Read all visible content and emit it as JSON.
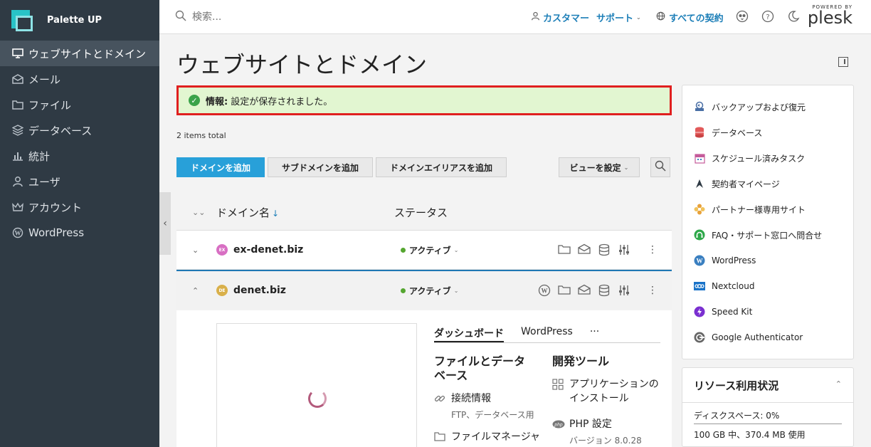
{
  "brand": {
    "name": "Palette UP"
  },
  "sidebar": {
    "items": [
      {
        "label": "ウェブサイトとドメイン",
        "icon": "monitor-icon",
        "active": true
      },
      {
        "label": "メール",
        "icon": "mail-icon"
      },
      {
        "label": "ファイル",
        "icon": "folder-icon"
      },
      {
        "label": "データベース",
        "icon": "database-icon"
      },
      {
        "label": "統計",
        "icon": "chart-icon"
      },
      {
        "label": "ユーザ",
        "icon": "user-icon"
      },
      {
        "label": "アカウント",
        "icon": "crown-icon"
      },
      {
        "label": "WordPress",
        "icon": "wordpress-icon"
      }
    ]
  },
  "topbar": {
    "search_placeholder": "検索...",
    "customer_label": "カスタマー",
    "support_label": "サポート",
    "subscriptions_label": "すべての契約",
    "plesk_powered": "POWERED BY",
    "plesk_name": "plesk"
  },
  "main": {
    "title": "ウェブサイトとドメイン",
    "info_label": "情報:",
    "info_text": "設定が保存されました。",
    "items_total": "2 items total",
    "buttons": {
      "add_domain": "ドメインを追加",
      "add_subdomain": "サブドメインを追加",
      "add_alias": "ドメインエイリアスを追加",
      "view_settings": "ビューを設定"
    },
    "columns": {
      "domain": "ドメイン名",
      "status": "ステータス"
    },
    "domains": [
      {
        "badge": "EX",
        "name": "ex-denet.biz",
        "status": "アクティブ"
      },
      {
        "badge": "DE",
        "name": "denet.biz",
        "status": "アクティブ"
      }
    ],
    "detail": {
      "tabs": [
        "ダッシュボード",
        "WordPress",
        "···"
      ],
      "files_title": "ファイルとデータベース",
      "connect_info": "接続情報",
      "connect_sub": "FTP、データベース用",
      "file_manager": "ファイルマネージャ",
      "dev_title": "開発ツール",
      "app_install": "アプリケーションのインストール",
      "php_settings": "PHP 設定",
      "php_version": "バージョン 8.0.28"
    }
  },
  "rpanel": {
    "items": [
      {
        "label": "バックアップおよび復元",
        "icon": "backup-icon",
        "color": "#4a6fa5"
      },
      {
        "label": "データベース",
        "icon": "database-icon",
        "color": "#e25a5a"
      },
      {
        "label": "スケジュール済みタスク",
        "icon": "calendar-icon",
        "color": "#c45a9a"
      },
      {
        "label": "契約者マイページ",
        "icon": "arrow-logo-icon",
        "color": "#2f3a44"
      },
      {
        "label": "パートナー様専用サイト",
        "icon": "flower-icon",
        "color": "#e8a23b"
      },
      {
        "label": "FAQ・サポート窓口へ問合せ",
        "icon": "headset-icon",
        "color": "#2ea84a"
      },
      {
        "label": "WordPress",
        "icon": "wordpress-icon",
        "color": "#3a7fc0"
      },
      {
        "label": "Nextcloud",
        "icon": "nextcloud-icon",
        "color": "#1a73c8"
      },
      {
        "label": "Speed Kit",
        "icon": "speedkit-icon",
        "color": "#7a2fd0"
      },
      {
        "label": "Google Authenticator",
        "icon": "authenticator-icon",
        "color": "#666666"
      }
    ],
    "resources_title": "リソース利用状況",
    "disk_label": "ディスクスペース: 0%",
    "disk_usage": "100 GB 中、370.4 MB 使用"
  }
}
